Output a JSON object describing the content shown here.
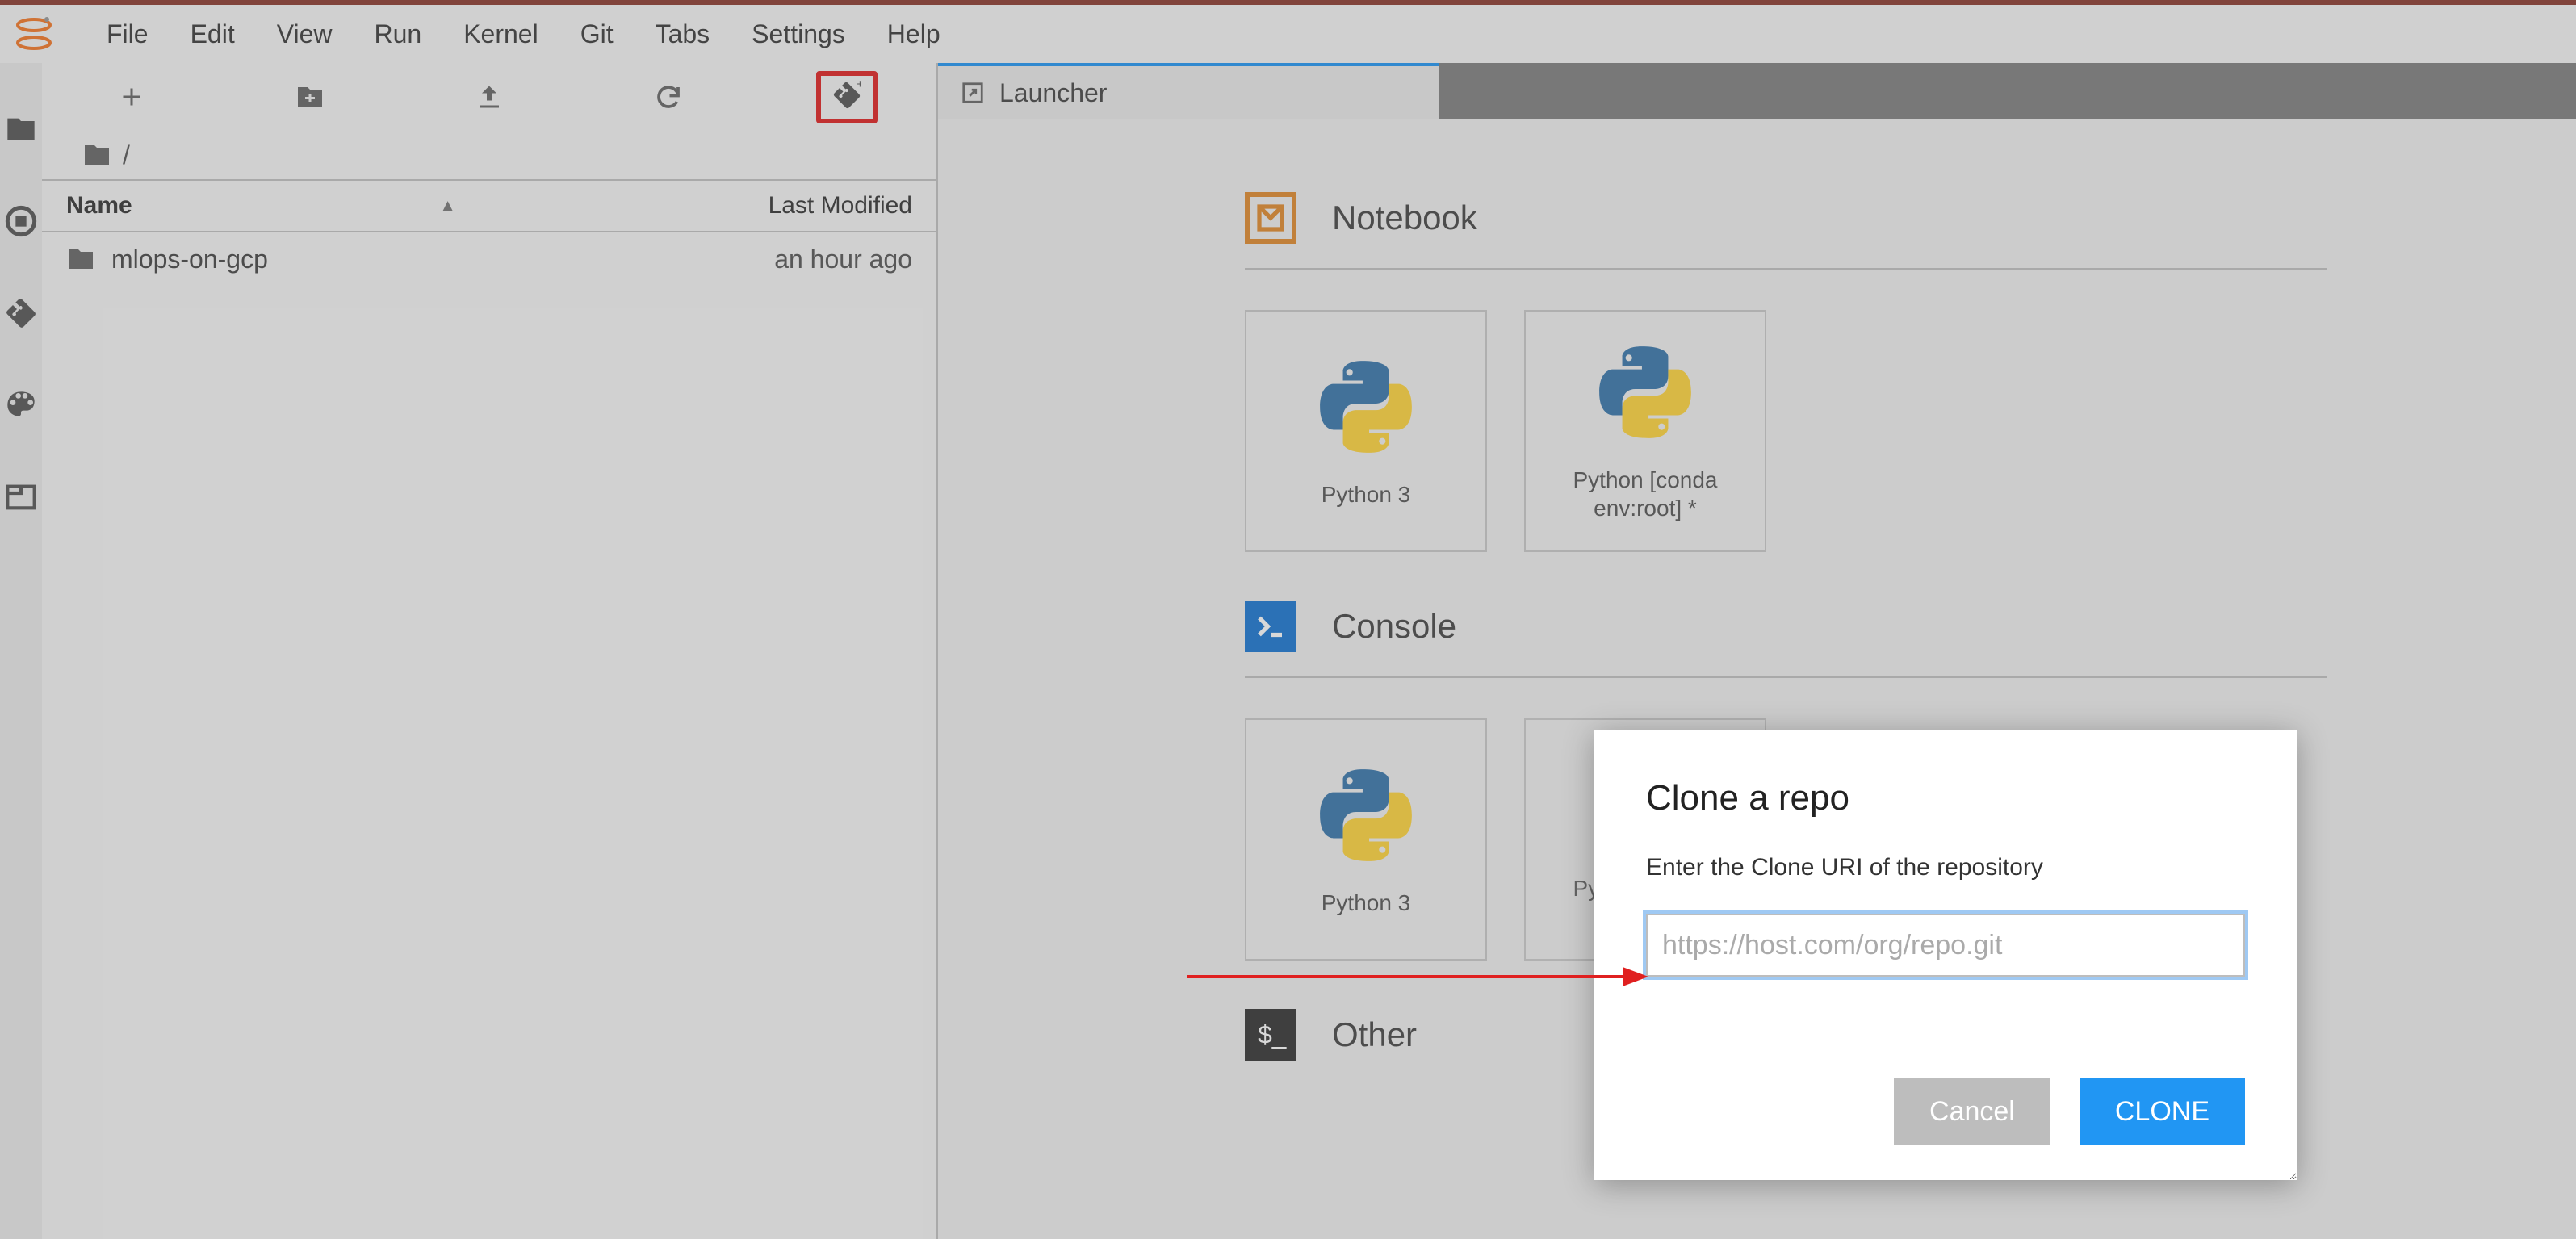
{
  "menubar": {
    "items": [
      "File",
      "Edit",
      "View",
      "Run",
      "Kernel",
      "Git",
      "Tabs",
      "Settings",
      "Help"
    ]
  },
  "breadcrumb": {
    "path": "/"
  },
  "file_browser": {
    "columns": {
      "name": "Name",
      "modified": "Last Modified"
    },
    "rows": [
      {
        "name": "mlops-on-gcp",
        "modified": "an hour ago"
      }
    ]
  },
  "tab": {
    "label": "Launcher"
  },
  "launcher": {
    "sections": [
      {
        "title": "Notebook",
        "cards": [
          "Python 3",
          "Python [conda env:root] *"
        ]
      },
      {
        "title": "Console",
        "cards": [
          "Python 3",
          "Python [conda env:root] *"
        ]
      },
      {
        "title": "Other",
        "cards": []
      }
    ]
  },
  "dialog": {
    "title": "Clone a repo",
    "prompt": "Enter the Clone URI of the repository",
    "placeholder": "https://host.com/org/repo.git",
    "cancel": "Cancel",
    "clone": "CLONE"
  }
}
